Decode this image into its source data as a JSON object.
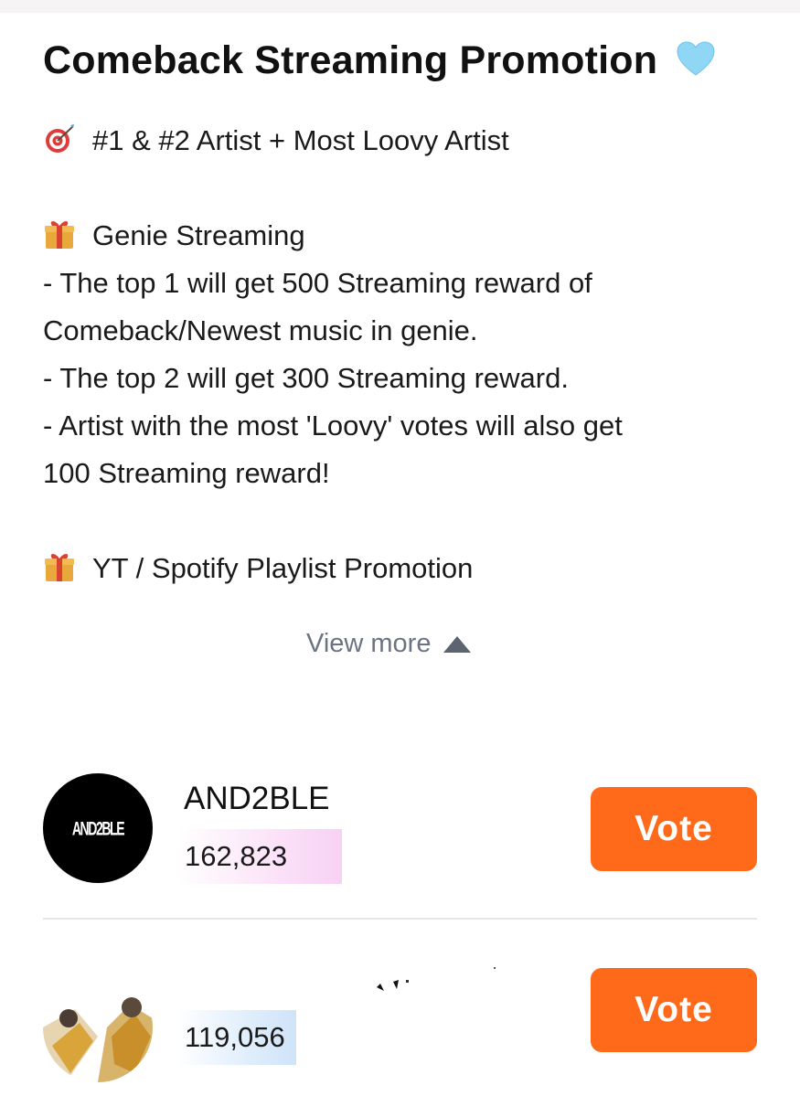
{
  "promotion": {
    "title": "Comeback Streaming Promotion",
    "title_icon": "light-blue-heart-emoji",
    "lines": [
      {
        "icon": "target-emoji",
        "text": "#1 & #2 Artist + Most Loovy Artist"
      },
      {
        "icon": "",
        "text": ""
      },
      {
        "icon": "gift-emoji",
        "text": "Genie Streaming"
      },
      {
        "icon": "",
        "text": "- The top 1 will get 500 Streaming reward of"
      },
      {
        "icon": "",
        "text": "Comeback/Newest music in genie."
      },
      {
        "icon": "",
        "text": "- The top 2 will get 300 Streaming reward."
      },
      {
        "icon": "",
        "text": "- Artist with the most 'Loovy' votes will also get"
      },
      {
        "icon": "",
        "text": "100 Streaming reward!"
      },
      {
        "icon": "",
        "text": ""
      },
      {
        "icon": "gift-emoji",
        "text": "YT / Spotify Playlist Promotion"
      }
    ],
    "view_more_label": "View more",
    "view_more_icon": "triangle-up-icon"
  },
  "ranking": [
    {
      "name": "AND2BLE",
      "avatar_text": "AND2BLE",
      "votes": "162,823",
      "vote_label": "Vote"
    },
    {
      "name": "",
      "votes": "119,056",
      "vote_label": "Vote"
    }
  ],
  "colors": {
    "accent": "#ff6a1a",
    "muted_text": "#6b7480",
    "divider": "#e5e5e5"
  }
}
